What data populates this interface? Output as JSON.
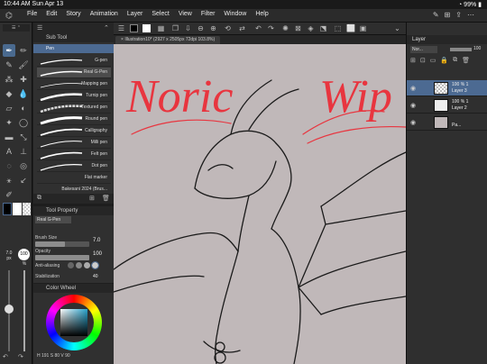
{
  "status": {
    "time": "10:44 AM",
    "date": "Sun Apr 13",
    "battery": "99%"
  },
  "menu": {
    "items": [
      "File",
      "Edit",
      "Story",
      "Animation",
      "Layer",
      "Select",
      "View",
      "Filter",
      "Window",
      "Help"
    ]
  },
  "canvas_tab": {
    "title": "Illustration10* (2927 x 2505px 72dpi 103.8%)"
  },
  "sub_tool": {
    "header": "Sub Tool",
    "group": "Pen",
    "brushes": [
      "G-pen",
      "Real G-Pen",
      "Mapping pen",
      "Turnip pen",
      "Textured pen",
      "Round pen",
      "Calligraphy",
      "Milli pen",
      "Felt pen",
      "Dot pen",
      "Flat marker",
      "Bakesani 2024 (Brus..."
    ]
  },
  "tool_property": {
    "header": "Tool Property",
    "brush_name": "Real G-Pen",
    "brush_size_label": "Brush Size",
    "brush_size_value": "7.0",
    "opacity_label": "Opacity",
    "opacity_value": "100",
    "anti_aliasing_label": "Anti-aliasing",
    "stabilization_label": "Stabilization",
    "stabilization_value": "40"
  },
  "color_wheel": {
    "header": "Color Wheel",
    "values": "H 191 S 80 V 90"
  },
  "left_strip": {
    "size_value": "7.0",
    "size_unit": "px",
    "opacity_value": "100",
    "opacity_unit": "%"
  },
  "layer_panel": {
    "header": "Layer",
    "blend_mode": "Nor...",
    "opacity": "100",
    "layers": [
      {
        "opacity": "100 % 1",
        "name": "Layer 3"
      },
      {
        "opacity": "100 % 1",
        "name": "Layer 2"
      },
      {
        "opacity": "",
        "name": "Pa..."
      }
    ]
  },
  "colors": {
    "accent": "#4c6a92",
    "canvas": "#c0b8b9",
    "red_text": "#e8353f",
    "panel": "#303030"
  },
  "canvas_text": {
    "word1": "Noric",
    "word2": "Wip"
  }
}
